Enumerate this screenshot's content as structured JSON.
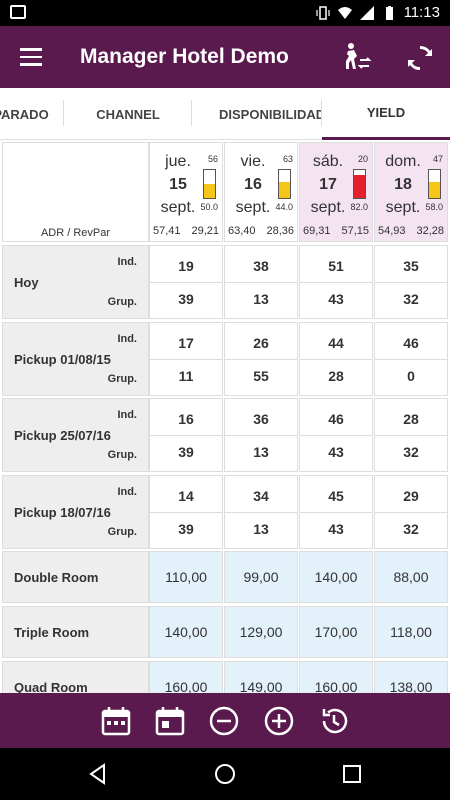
{
  "status": {
    "time": "11:13"
  },
  "appbar": {
    "title": "Manager Hotel Demo",
    "icons": [
      "menu-icon",
      "person-walking-icon",
      "refresh-icon"
    ]
  },
  "tabs": [
    {
      "label": "PARADO"
    },
    {
      "label": "CHANNEL"
    },
    {
      "label": "DISPONIBILIDAD"
    },
    {
      "label": "YIELD",
      "active": true
    }
  ],
  "header": {
    "left_label": "ADR / RevPar"
  },
  "days": [
    {
      "name": "jue.",
      "day": "15",
      "month": "sept.",
      "top": "56",
      "bottom": "50.0",
      "fill_pct": 50,
      "fill_color": "#f5c518",
      "adr": "57,41",
      "revpar": "29,21",
      "weekend": false
    },
    {
      "name": "vie.",
      "day": "16",
      "month": "sept.",
      "top": "63",
      "bottom": "44.0",
      "fill_pct": 56,
      "fill_color": "#f5c518",
      "adr": "63,40",
      "revpar": "28,36",
      "weekend": false
    },
    {
      "name": "sáb.",
      "day": "17",
      "month": "sept.",
      "top": "20",
      "bottom": "82.0",
      "fill_pct": 82,
      "fill_color": "#e5202e",
      "adr": "69,31",
      "revpar": "57,15",
      "weekend": true
    },
    {
      "name": "dom.",
      "day": "18",
      "month": "sept.",
      "top": "47",
      "bottom": "58.0",
      "fill_pct": 58,
      "fill_color": "#f5c518",
      "adr": "54,93",
      "revpar": "32,28",
      "weekend": true
    }
  ],
  "rows": [
    {
      "label": "Hoy",
      "ind_label": "Ind.",
      "grp_label": "Grup.",
      "ind": [
        "19",
        "38",
        "51",
        "35"
      ],
      "grp": [
        "39",
        "13",
        "43",
        "32"
      ]
    },
    {
      "label": "Pickup 01/08/15",
      "ind_label": "Ind.",
      "grp_label": "Grup.",
      "ind": [
        "17",
        "26",
        "44",
        "46"
      ],
      "grp": [
        "11",
        "55",
        "28",
        "0"
      ]
    },
    {
      "label": "Pickup 25/07/16",
      "ind_label": "Ind.",
      "grp_label": "Grup.",
      "ind": [
        "16",
        "36",
        "46",
        "28"
      ],
      "grp": [
        "39",
        "13",
        "43",
        "32"
      ]
    },
    {
      "label": "Pickup 18/07/16",
      "ind_label": "Ind.",
      "grp_label": "Grup.",
      "ind": [
        "14",
        "34",
        "45",
        "29"
      ],
      "grp": [
        "39",
        "13",
        "43",
        "32"
      ]
    }
  ],
  "prices": [
    {
      "label": "Double Room",
      "values": [
        "110,00",
        "99,00",
        "140,00",
        "88,00"
      ]
    },
    {
      "label": "Triple Room",
      "values": [
        "140,00",
        "129,00",
        "170,00",
        "118,00"
      ]
    },
    {
      "label": "Quad Room",
      "values": [
        "160,00",
        "149,00",
        "160,00",
        "138,00"
      ]
    }
  ],
  "bottom_icons": [
    "calendar-range-icon",
    "calendar-icon",
    "minus-circle-icon",
    "plus-circle-icon",
    "history-icon"
  ]
}
